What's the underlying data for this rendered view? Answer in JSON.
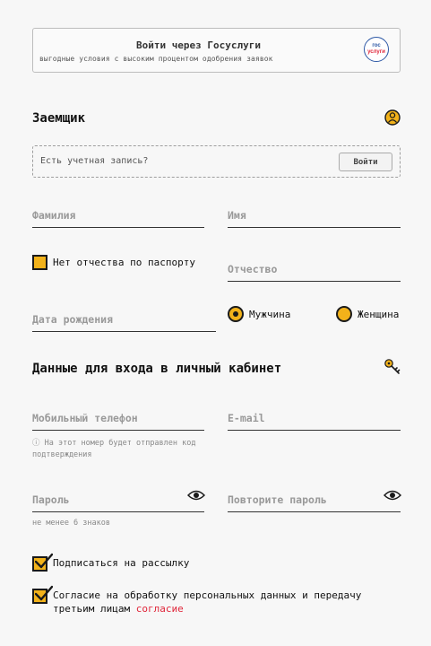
{
  "gosuslugi": {
    "title": "Войти через Госуслуги",
    "subtitle": "выгодные условия с высоким процентом одобрения заявок",
    "logo_line1": "гос",
    "logo_line2": "услуги"
  },
  "borrower": {
    "title": "Заемщик",
    "icon": "user-icon",
    "account_question": "Есть учетная запись?",
    "login_button": "Войти",
    "last_name_placeholder": "Фамилия",
    "first_name_placeholder": "Имя",
    "no_patronymic_label": "Нет отчества по паспорту",
    "patronymic_placeholder": "Отчество",
    "birth_date_placeholder": "Дата рождения",
    "gender_male": "Мужчина",
    "gender_female": "Женщина",
    "selected_gender": "male"
  },
  "login_data": {
    "title": "Данные для входа в личный кабинет",
    "icon": "key-icon",
    "phone_placeholder": "Мобильный телефон",
    "phone_hint": "ⓘ На этот номер будет отправлен код подтверждения",
    "email_placeholder": "E-mail",
    "password_placeholder": "Пароль",
    "password_hint": "не менее 6 знаков",
    "repeat_password_placeholder": "Повторите пароль"
  },
  "consents": {
    "newsletter_label": "Подписаться на рассылку",
    "newsletter_checked": true,
    "personal_data_label": "Согласие на обработку персональных данных и передачу третьим лицам",
    "personal_data_link": "согласие",
    "personal_data_checked": true
  },
  "colors": {
    "accent": "#f2b21a",
    "link": "#e0263a",
    "gos_blue": "#2c57a5"
  }
}
